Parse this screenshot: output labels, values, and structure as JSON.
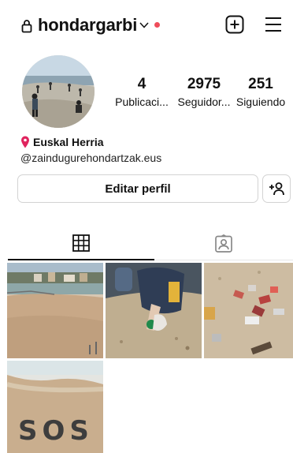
{
  "header": {
    "username": "hondargarbi",
    "icons": [
      "lock-icon",
      "chevron-down-icon",
      "notification-dot",
      "new-post-icon",
      "menu-icon"
    ],
    "notification_color": "#ef4d5a"
  },
  "profile": {
    "stats": [
      {
        "value": "4",
        "label": "Publicaci..."
      },
      {
        "value": "2975",
        "label": "Seguidor..."
      },
      {
        "value": "251",
        "label": "Siguiendo"
      }
    ],
    "location": "Euskal Herria",
    "website": "@zaindugurehondartzak.eus",
    "edit_label": "Editar perfil"
  },
  "tabs": [
    {
      "name": "grid",
      "icon": "grid-icon",
      "active": true
    },
    {
      "name": "tagged",
      "icon": "tagged-person-icon",
      "active": false
    }
  ],
  "posts": {
    "count": 4,
    "overlay_text": "SOS"
  }
}
